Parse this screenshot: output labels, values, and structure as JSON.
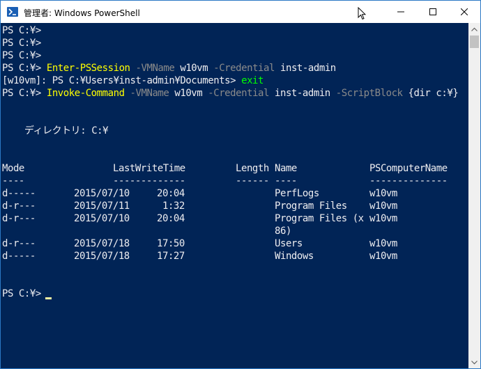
{
  "window": {
    "title": "管理者: Windows PowerShell",
    "icons": {
      "app": "powershell-icon",
      "minimize": "minimize-icon",
      "maximize": "maximize-icon",
      "close": "close-icon"
    }
  },
  "colors": {
    "console_bg": "#012456",
    "console_fg": "#eeedf0",
    "command": "#ffff00",
    "parameter": "#8a8a8a",
    "exit_keyword": "#00ff00",
    "cursor": "#f7f7a3"
  },
  "console": {
    "lines": [
      {
        "prompt": "PS C:¥> "
      },
      {
        "prompt": "PS C:¥> "
      },
      {
        "prompt": "PS C:¥> "
      },
      {
        "prompt": "PS C:¥> ",
        "cmd": "Enter-PSSession",
        "p1": " -VMName ",
        "a1": "w10vm",
        "p2": " -Credential ",
        "a2": "inst-admin"
      },
      {
        "prompt": "[w10vm]: PS C:¥Users¥inst-admin¥Documents> ",
        "exit": "exit"
      },
      {
        "prompt": "PS C:¥> ",
        "cmd": "Invoke-Command",
        "p1": " -VMName ",
        "a1": "w10vm",
        "p2": " -Credential ",
        "a2": "inst-admin",
        "p3": " -ScriptBlock ",
        "a3": "{dir c:¥}"
      }
    ],
    "directory_label": "    ディレクトリ: C:¥",
    "table": {
      "headers": {
        "mode": "Mode",
        "lastwrite": "LastWriteTime",
        "length": "Length",
        "name": "Name",
        "computer": "PSComputerName"
      },
      "underlines": {
        "mode": "----",
        "lastwrite": "-------------",
        "length": "------",
        "name": "----",
        "computer": "--------------"
      },
      "rows": [
        {
          "mode": "d-----",
          "date": "2015/07/10",
          "time": "20:04",
          "name": "PerfLogs",
          "computer": "w10vm"
        },
        {
          "mode": "d-r---",
          "date": "2015/07/11",
          "time": " 1:32",
          "name": "Program Files",
          "computer": "w10vm"
        },
        {
          "mode": "d-r---",
          "date": "2015/07/10",
          "time": "20:04",
          "name": "Program Files (x",
          "name2": "86)",
          "computer": "w10vm"
        },
        {
          "mode": "d-r---",
          "date": "2015/07/18",
          "time": "17:50",
          "name": "Users",
          "computer": "w10vm"
        },
        {
          "mode": "d-----",
          "date": "2015/07/18",
          "time": "17:27",
          "name": "Windows",
          "computer": "w10vm"
        }
      ]
    },
    "final_prompt": "PS C:¥> "
  }
}
